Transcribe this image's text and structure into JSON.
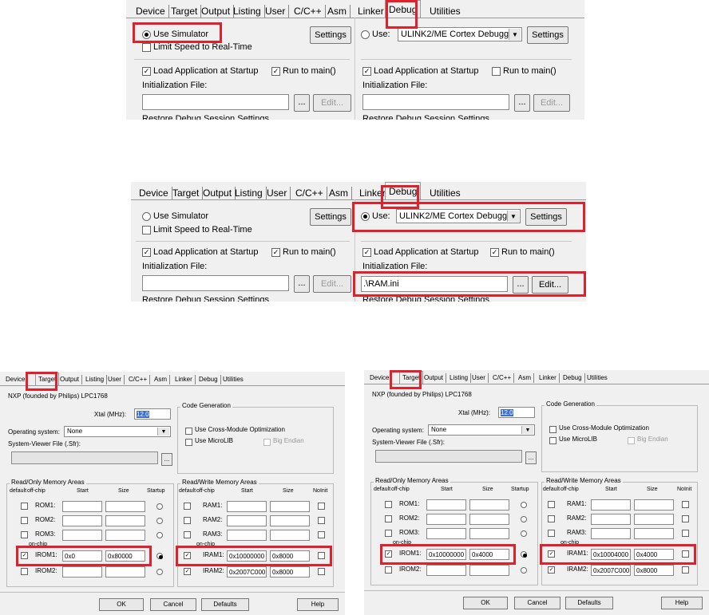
{
  "tabs": [
    "Device",
    "Target",
    "Output",
    "Listing",
    "User",
    "C/C++",
    "Asm",
    "Linker",
    "Debug",
    "Utilities"
  ],
  "simulator": {
    "use_simulator": "Use Simulator",
    "limit_speed": "Limit Speed to Real-Time",
    "settings": "Settings",
    "load_app": "Load Application at Startup",
    "run_to_main": "Run to main()",
    "init_file": "Initialization File:",
    "browse": "...",
    "edit": "Edit...",
    "restore": "Restore Debug Session Settings"
  },
  "hardware": {
    "use": "Use:",
    "debugger": "ULINK2/ME Cortex Debugger",
    "settings": "Settings",
    "load_app": "Load Application at Startup",
    "run_to_main": "Run to main()",
    "init_file": "Initialization File:",
    "init_value": ".\\RAM.ini",
    "browse": "...",
    "edit": "Edit...",
    "restore": "Restore Debug Session Settings"
  },
  "target": {
    "device": "NXP (founded by Philips) LPC1768",
    "xtal_label": "Xtal (MHz):",
    "xtal_value": "12.0",
    "os_label": "Operating system:",
    "os_value": "None",
    "sv_label": "System-Viewer File (.Sfr):",
    "code_gen": "Code Generation",
    "cross_module": "Use Cross-Module Optimization",
    "microlib": "Use MicroLIB",
    "big_endian": "Big Endian",
    "ro_title": "Read/Only Memory Areas",
    "rw_title": "Read/Write Memory Areas",
    "col_default": "default",
    "col_offchip": "off-chip",
    "col_start": "Start",
    "col_size": "Size",
    "col_startup": "Startup",
    "col_noinit": "NoInit",
    "rom_names": [
      "ROM1:",
      "ROM2:",
      "ROM3:"
    ],
    "on_chip": "on-chip",
    "irom_names": [
      "IROM1:",
      "IROM2:"
    ],
    "ram_names": [
      "RAM1:",
      "RAM2:",
      "RAM3:"
    ],
    "iram_names": [
      "IRAM1:",
      "IRAM2:"
    ],
    "ok": "OK",
    "cancel": "Cancel",
    "defaults": "Defaults",
    "help": "Help",
    "left": {
      "irom1_start": "0x0",
      "irom1_size": "0x80000",
      "iram1_start": "0x10000000",
      "iram1_size": "0x8000",
      "iram2_start": "0x2007C000",
      "iram2_size": "0x8000"
    },
    "right": {
      "irom1_start": "0x10000000",
      "irom1_size": "0x4000",
      "iram1_start": "0x10004000",
      "iram1_size": "0x4000",
      "iram2_start": "0x2007C000",
      "iram2_size": "0x8000"
    }
  },
  "accent_color": "#e0202a"
}
